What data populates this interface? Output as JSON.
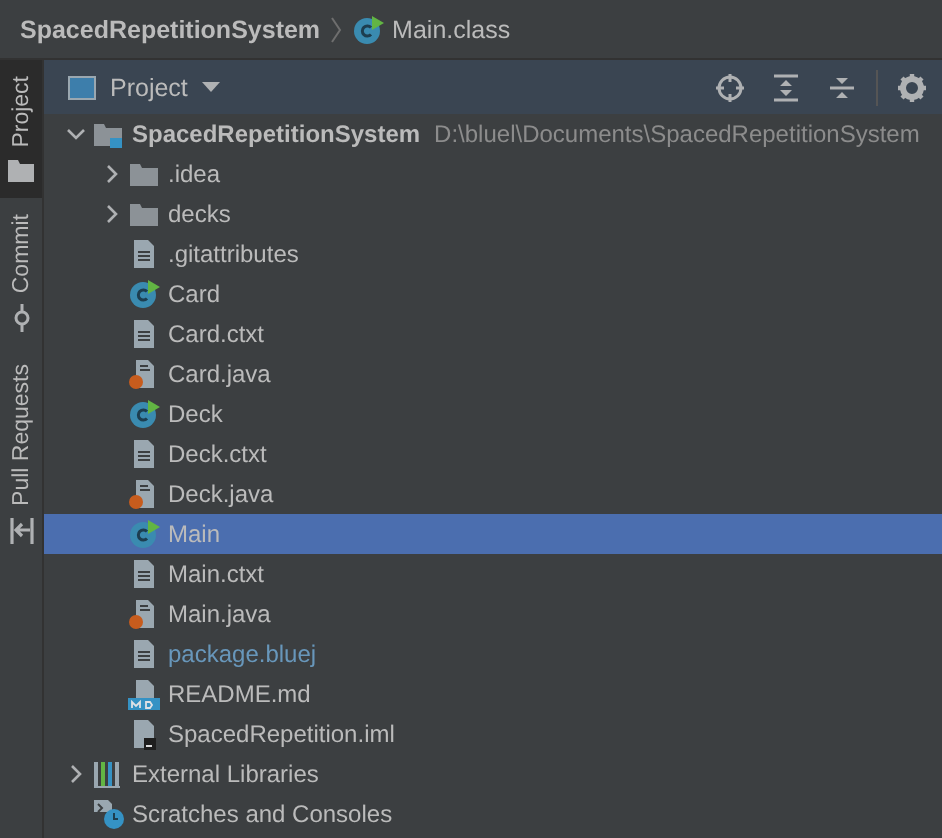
{
  "breadcrumb": [
    {
      "label": "SpacedRepetitionSystem",
      "kind": "project"
    },
    {
      "label": "Main.class",
      "kind": "class"
    }
  ],
  "tool_strip": [
    {
      "label": "Project",
      "kind": "project",
      "selected": true
    },
    {
      "label": "Commit",
      "kind": "commit",
      "selected": false
    },
    {
      "label": "Pull Requests",
      "kind": "pull",
      "selected": false
    }
  ],
  "panel": {
    "title": "Project"
  },
  "tree": [
    {
      "label": "SpacedRepetitionSystem",
      "path": "D:\\bluel\\Documents\\SpacedRepetitionSystem",
      "kind": "project",
      "expanded": true,
      "selected": false,
      "children": [
        {
          "label": ".idea",
          "kind": "folder",
          "expanded": false,
          "selected": false
        },
        {
          "label": "decks",
          "kind": "folder",
          "expanded": false,
          "selected": false
        },
        {
          "label": ".gitattributes",
          "kind": "text",
          "modified": false,
          "selected": false
        },
        {
          "label": "Card",
          "kind": "class",
          "modified": false,
          "selected": false
        },
        {
          "label": "Card.ctxt",
          "kind": "text",
          "modified": false,
          "selected": false
        },
        {
          "label": "Card.java",
          "kind": "java",
          "modified": false,
          "selected": false
        },
        {
          "label": "Deck",
          "kind": "class",
          "modified": false,
          "selected": false
        },
        {
          "label": "Deck.ctxt",
          "kind": "text",
          "modified": false,
          "selected": false
        },
        {
          "label": "Deck.java",
          "kind": "java",
          "modified": false,
          "selected": false
        },
        {
          "label": "Main",
          "kind": "class",
          "modified": false,
          "selected": true
        },
        {
          "label": "Main.ctxt",
          "kind": "text",
          "modified": false,
          "selected": false
        },
        {
          "label": "Main.java",
          "kind": "java",
          "modified": false,
          "selected": false
        },
        {
          "label": "package.bluej",
          "kind": "text",
          "modified": true,
          "selected": false
        },
        {
          "label": "README.md",
          "kind": "markdown",
          "modified": false,
          "selected": false
        },
        {
          "label": "SpacedRepetition.iml",
          "kind": "iml",
          "modified": false,
          "selected": false
        }
      ]
    },
    {
      "label": "External Libraries",
      "kind": "libraries",
      "expanded": false,
      "selected": false
    },
    {
      "label": "Scratches and Consoles",
      "kind": "scratches",
      "selected": false
    }
  ]
}
